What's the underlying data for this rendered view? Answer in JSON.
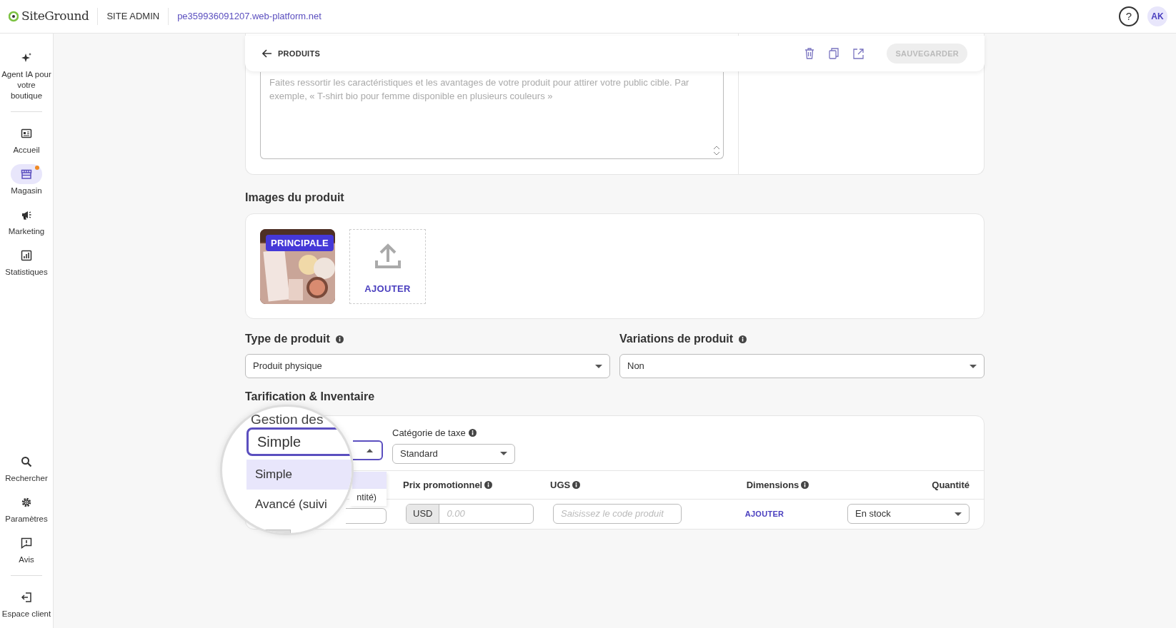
{
  "header": {
    "logo": "SiteGround",
    "section": "SITE ADMIN",
    "domain": "pe359936091207.web-platform.net",
    "help": "?",
    "avatar": "AK"
  },
  "sidebar": {
    "top": [
      {
        "kind": "sparkle",
        "label": "Agent IA pour votre boutique",
        "selected": false,
        "badge": false
      }
    ],
    "items": [
      {
        "kind": "home",
        "label": "Accueil",
        "selected": false,
        "badge": false
      },
      {
        "kind": "store",
        "label": "Magasin",
        "selected": true,
        "badge": true
      },
      {
        "kind": "megaphone",
        "label": "Marketing",
        "selected": false,
        "badge": false
      },
      {
        "kind": "chart",
        "label": "Statistiques",
        "selected": false,
        "badge": false
      }
    ],
    "bottom": [
      {
        "kind": "search",
        "label": "Rechercher",
        "selected": false,
        "badge": false
      },
      {
        "kind": "gear",
        "label": "Paramètres",
        "selected": false,
        "badge": false
      },
      {
        "kind": "alert",
        "label": "Avis",
        "selected": false,
        "badge": false
      }
    ],
    "footer": [
      {
        "kind": "logout",
        "label": "Espace client",
        "selected": false,
        "badge": false
      }
    ]
  },
  "toolbar": {
    "back": "PRODUITS",
    "save": "SAUVEGARDER",
    "save_disabled": true
  },
  "description": {
    "placeholder": "Faites ressortir les caractéristiques et les avantages de votre produit pour attirer votre public cible. Par exemple, « T-shirt bio pour femme disponible en plusieurs couleurs »"
  },
  "images": {
    "title": "Images du produit",
    "badge": "PRINCIPALE",
    "add": "AJOUTER"
  },
  "product_type": {
    "label": "Type de produit",
    "value": "Produit physique"
  },
  "variations": {
    "label": "Variations de produit",
    "value": "Non"
  },
  "pricing": {
    "title": "Tarification & Inventaire",
    "tax_label": "Catégorie de taxe",
    "tax_value": "Standard",
    "popup_options": [
      {
        "selected": true
      },
      {
        "text": "ntité)",
        "selected": false
      }
    ],
    "columns": [
      {
        "label": "Prix promotionnel",
        "info": true
      },
      {
        "label": "UGS",
        "info": true
      },
      {
        "label": "Dimensions",
        "info": true
      },
      {
        "label": "Quantité",
        "info": false
      }
    ],
    "row": {
      "currency": "USD",
      "price_placeholder": "0.00",
      "sku_placeholder": "Saisissez le code produit",
      "dimensions": "AJOUTER",
      "quantity": "En stock"
    }
  },
  "magnifier": {
    "heading": "Gestion des",
    "value": "Simple",
    "options": [
      {
        "text": "Simple",
        "selected": true
      },
      {
        "text": "Avancé (suivi",
        "selected": false
      }
    ]
  }
}
